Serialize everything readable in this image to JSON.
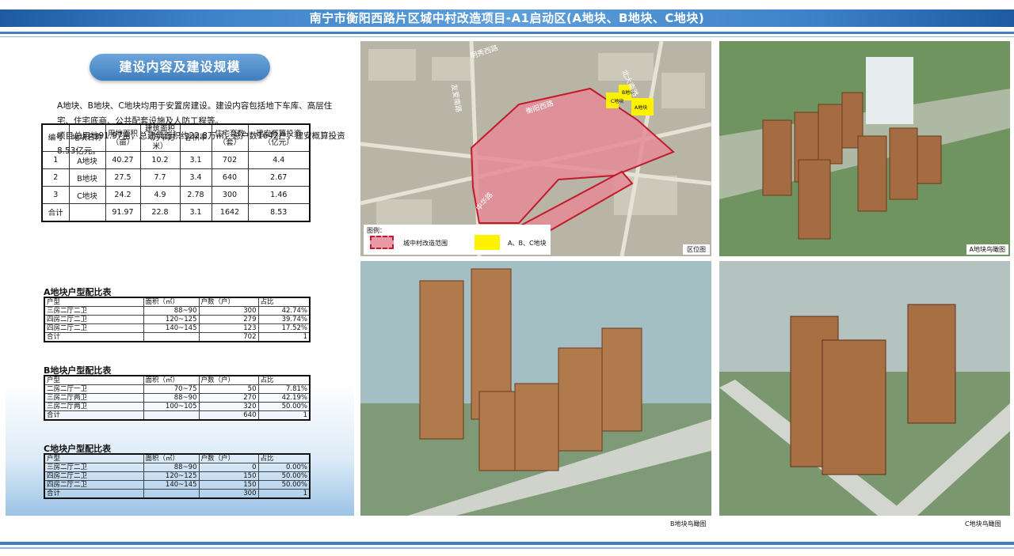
{
  "header": {
    "title": "南宁市衡阳西路片区城中村改造项目-A1启动区(A地块、B地块、C地块)"
  },
  "left": {
    "section_title": "建设内容及建设规模",
    "intro_p1": "A地块、B地块、C地块均用于安置房建设。建设内容包括地下车库、高层住宅、住宅底商、公共配套设施及人防工程等。",
    "intro_p2": "项目总用地91.97亩，总建筑面积约22.8万㎡，总户数1642户，建安概算投资8.53亿元。"
  },
  "summary_table": {
    "headers": [
      "编号",
      "地块名称",
      "用地面积\n（亩）",
      "建筑面积\n（万平方米）",
      "容积率",
      "住宅套数\n（套）",
      "建安概算投资\n（亿元）"
    ],
    "rows": [
      [
        "1",
        "A地块",
        "40.27",
        "10.2",
        "3.1",
        "702",
        "4.4"
      ],
      [
        "2",
        "B地块",
        "27.5",
        "7.7",
        "3.4",
        "640",
        "2.67"
      ],
      [
        "3",
        "C地块",
        "24.2",
        "4.9",
        "2.78",
        "300",
        "1.46"
      ],
      [
        "合计",
        "",
        "91.97",
        "22.8",
        "3.1",
        "1642",
        "8.53"
      ]
    ]
  },
  "mix_tables": [
    {
      "title": "A地块户型配比表",
      "headers": [
        "户型",
        "面积（㎡）",
        "户数（户）",
        "占比"
      ],
      "rows": [
        [
          "三房二厅二卫",
          "88~90",
          "300",
          "42.74%"
        ],
        [
          "四房二厅二卫",
          "120~125",
          "279",
          "39.74%"
        ],
        [
          "四房二厅二卫",
          "140~145",
          "123",
          "17.52%"
        ],
        [
          "合计",
          "",
          "702",
          "1"
        ]
      ]
    },
    {
      "title": "B地块户型配比表",
      "headers": [
        "户型",
        "面积（㎡）",
        "户数（户）",
        "占比"
      ],
      "rows": [
        [
          "二房二厅一卫",
          "70~75",
          "50",
          "7.81%"
        ],
        [
          "三房二厅两卫",
          "88~90",
          "270",
          "42.19%"
        ],
        [
          "三房二厅两卫",
          "100~105",
          "320",
          "50.00%"
        ],
        [
          "合计",
          "",
          "640",
          "1"
        ]
      ]
    },
    {
      "title": "C地块户型配比表",
      "headers": [
        "户型",
        "面积（㎡）",
        "户数（户）",
        "占比"
      ],
      "rows": [
        [
          "三房二厅二卫",
          "88~90",
          "0",
          "0.00%"
        ],
        [
          "四房二厅二卫",
          "120~125",
          "150",
          "50.00%"
        ],
        [
          "四房二厅二卫",
          "140~145",
          "150",
          "50.00%"
        ],
        [
          "合计",
          "",
          "300",
          "1"
        ]
      ]
    }
  ],
  "map": {
    "legend_title": "图例：",
    "legend_red": "城中村改造范围",
    "legend_yellow": "A、B、C地块",
    "tag": "区位图",
    "labels": [
      "明秀西路",
      "衡阳西路",
      "友爱南路",
      "北大南路",
      "中华路",
      "A地块",
      "B地块",
      "C地块"
    ]
  },
  "captions": {
    "aerial_a": "A地块鸟瞰图",
    "aerial_b": "B地块鸟瞰图",
    "aerial_c": "C地块鸟瞰图"
  },
  "colors": {
    "header_blue": "#3d82c8",
    "boundary_red": "#c21a2a",
    "block_yellow": "#fff200"
  }
}
